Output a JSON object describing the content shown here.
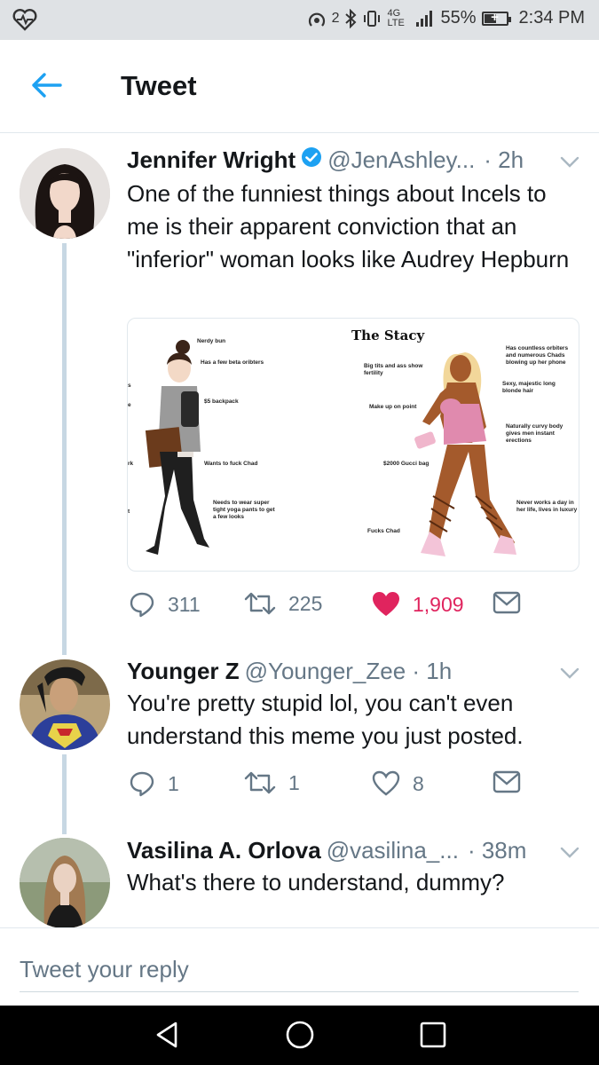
{
  "status_bar": {
    "signal_text": "4G LTE",
    "hotspot_count": "2",
    "battery": "55%",
    "battery_level": 0.55,
    "time": "2:34 PM"
  },
  "header": {
    "title": "Tweet"
  },
  "tweets": [
    {
      "name": "Jennifer Wright",
      "handle": "@JenAshley...",
      "time": "· 2h",
      "verified": true,
      "text": "One of the funniest things about Incels to me is their apparent conviction that an \"inferior\" woman looks like Audrey Hepburn",
      "replies": "311",
      "retweets": "225",
      "likes": "1,909",
      "liked": true
    },
    {
      "name": "Younger Z",
      "handle": "@Younger_Zee · 1h",
      "time": "",
      "text": "You're pretty stupid lol, you can't even understand this meme you just posted.",
      "replies": "1",
      "retweets": "1",
      "likes": "8"
    },
    {
      "name": "Vasilina A. Orlova",
      "handle": "@vasilina_...",
      "time": "· 38m",
      "text": "What's there to understand, dummy?"
    }
  ],
  "meme": {
    "title": "The Stacy",
    "left_labels": [
      "Nerdy bun",
      "Has a few beta oribters",
      "$5 backpack",
      "Wants to fuck Chad",
      "Needs to wear super tight yoga pants to get a few looks"
    ],
    "middle_labels": [
      "Big tits and ass show fertility",
      "Make up on point",
      "$2000 Gucci bag",
      "Fucks Chad"
    ],
    "right_labels": [
      "Has countless orbiters and numerous Chads blowing up her phone",
      "Sexy, majestic long blonde hair",
      "Naturally curvy body gives men instant erections",
      "Never works a day in her life, lives in luxury"
    ],
    "edge_fragments": [
      "s",
      "e",
      "rk",
      "t"
    ]
  },
  "reply_bar": {
    "placeholder": "Tweet your reply"
  },
  "colors": {
    "twitter_blue": "#1da1f2",
    "like_red": "#e0245e",
    "gray": "#657786",
    "thread": "#c7d7e3"
  }
}
